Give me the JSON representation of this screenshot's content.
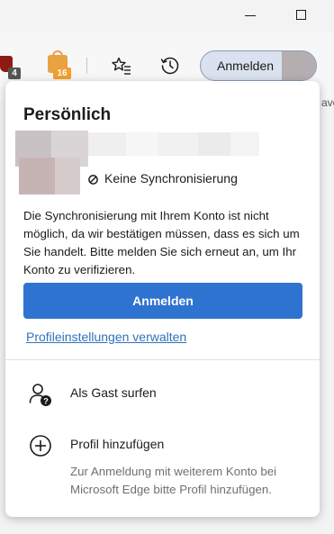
{
  "toolbar": {
    "ublock_badge": "4",
    "shopping_badge": "16",
    "signin_label": "Anmelden",
    "cut_off_text": "avo"
  },
  "popup": {
    "heading": "Persönlich",
    "sync_status": "Keine Synchronisierung",
    "message": "Die Synchronisierung mit Ihrem Konto ist nicht möglich, da wir bestätigen müssen, dass es sich um Sie handelt. Bitte melden Sie sich erneut an, um Ihr Konto zu verifizieren.",
    "signin_button": "Anmelden",
    "profile_settings_link": "Profileinstellungen verwalten",
    "menu": [
      {
        "label": "Als Gast surfen",
        "icon": "guest-icon"
      },
      {
        "label": "Profil hinzufügen",
        "icon": "add-circle-icon"
      }
    ],
    "add_profile_description": "Zur Anmeldung mit weiterem Konto bei Microsoft Edge bitte Profil hinzufügen."
  },
  "colors": {
    "accent": "#2f73d0",
    "link": "#2f73b8"
  }
}
